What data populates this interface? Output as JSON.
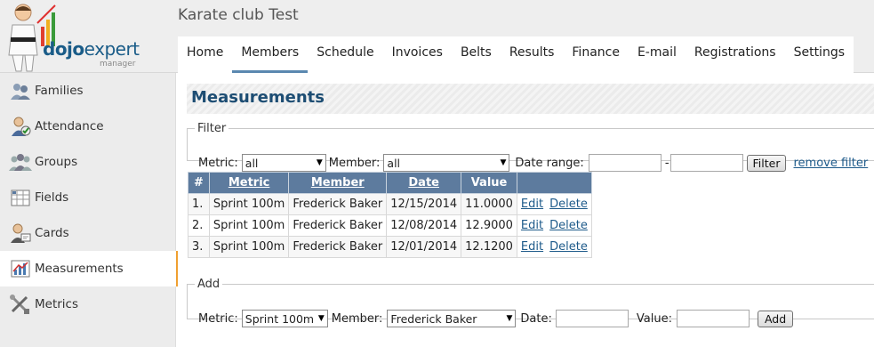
{
  "header": {
    "club_title": "Karate club Test",
    "logo": {
      "brand_a": "dojo",
      "brand_b": "expert",
      "sub": "manager"
    }
  },
  "topnav": [
    {
      "label": "Home"
    },
    {
      "label": "Members",
      "active": true
    },
    {
      "label": "Schedule"
    },
    {
      "label": "Invoices"
    },
    {
      "label": "Belts"
    },
    {
      "label": "Results"
    },
    {
      "label": "Finance"
    },
    {
      "label": "E-mail"
    },
    {
      "label": "Registrations"
    },
    {
      "label": "Settings"
    }
  ],
  "sidebar": {
    "items": [
      {
        "label": "Families",
        "icon": "families-icon"
      },
      {
        "label": "Attendance",
        "icon": "attendance-icon"
      },
      {
        "label": "Groups",
        "icon": "groups-icon"
      },
      {
        "label": "Fields",
        "icon": "fields-icon"
      },
      {
        "label": "Cards",
        "icon": "cards-icon"
      },
      {
        "label": "Measurements",
        "icon": "measurements-icon",
        "active": true
      },
      {
        "label": "Metrics",
        "icon": "metrics-icon"
      }
    ]
  },
  "page": {
    "title": "Measurements"
  },
  "filter": {
    "legend": "Filter",
    "metric_label": "Metric:",
    "metric_value": "all",
    "member_label": "Member:",
    "member_value": "all",
    "date_range_label": "Date range:",
    "date_from": "",
    "dash": "-",
    "date_to": "",
    "filter_button": "Filter",
    "remove_filter": "remove filter"
  },
  "table": {
    "columns": [
      "#",
      "Metric",
      "Member",
      "Date",
      "Value"
    ],
    "rows": [
      {
        "n": "1.",
        "metric": "Sprint 100m",
        "member": "Frederick Baker",
        "date": "12/15/2014",
        "value": "11.0000"
      },
      {
        "n": "2.",
        "metric": "Sprint 100m",
        "member": "Frederick Baker",
        "date": "12/08/2014",
        "value": "12.9000"
      },
      {
        "n": "3.",
        "metric": "Sprint 100m",
        "member": "Frederick Baker",
        "date": "12/01/2014",
        "value": "12.1200"
      }
    ],
    "edit_label": "Edit",
    "delete_label": "Delete"
  },
  "add": {
    "legend": "Add",
    "metric_label": "Metric:",
    "metric_value": "Sprint 100m",
    "member_label": "Member:",
    "member_value": "Frederick Baker",
    "date_label": "Date:",
    "date_value": "",
    "value_label": "Value:",
    "value_value": "",
    "add_button": "Add"
  },
  "colors": {
    "accent": "#1d4d73",
    "table_header": "#5d7b9e",
    "active_marker": "#f0a030",
    "link": "#1d5a8a"
  }
}
